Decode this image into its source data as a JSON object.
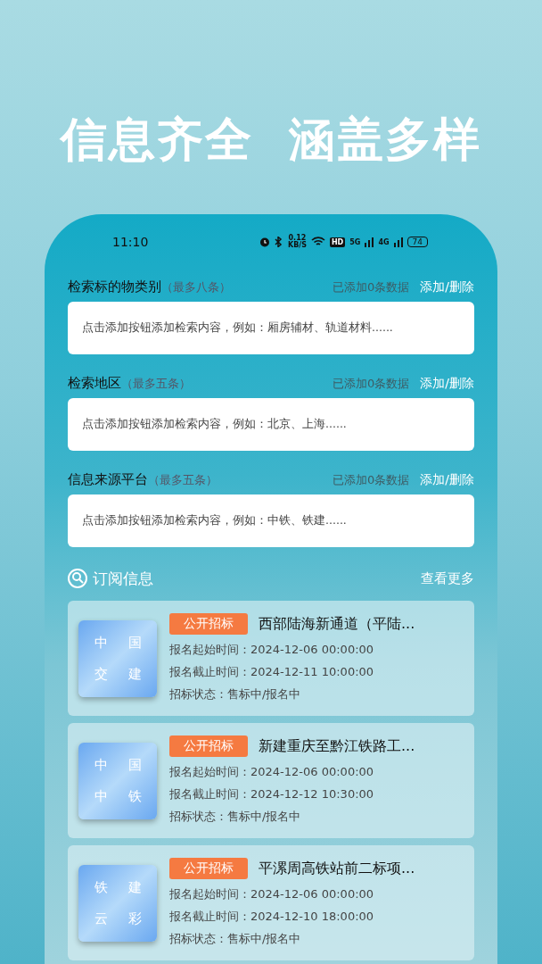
{
  "headline": [
    "信息齐全",
    "涵盖多样"
  ],
  "status_bar": {
    "time": "11:10",
    "speed": "0.12",
    "speed_unit": "KB/S",
    "hd": "HD",
    "net_1": "5G",
    "net_2": "4G",
    "battery": "74"
  },
  "filters": [
    {
      "title": "检索标的物类别",
      "limit": "（最多八条）",
      "count": "已添加0条数据",
      "action": "添加/删除",
      "placeholder": "点击添加按钮添加检索内容，例如：厢房辅材、轨道材料......"
    },
    {
      "title": "检索地区",
      "limit": "（最多五条）",
      "count": "已添加0条数据",
      "action": "添加/删除",
      "placeholder": "点击添加按钮添加检索内容，例如：北京、上海......"
    },
    {
      "title": "信息来源平台",
      "limit": "（最多五条）",
      "count": "已添加0条数据",
      "action": "添加/删除",
      "placeholder": "点击添加按钮添加检索内容，例如：中铁、铁建......"
    }
  ],
  "subscribe": {
    "title": "订阅信息",
    "more": "查看更多",
    "items": [
      {
        "logo": [
          "中",
          "国",
          "交",
          "建"
        ],
        "badge": "公开招标",
        "title": "西部陆海新通道（平陆...",
        "lines": [
          {
            "label": "报名起始时间：",
            "value": "2024-12-06 00:00:00"
          },
          {
            "label": "报名截止时间：",
            "value": "2024-12-11 10:00:00"
          },
          {
            "label": "招标状态：",
            "value": "售标中/报名中"
          }
        ]
      },
      {
        "logo": [
          "中",
          "国",
          "中",
          "铁"
        ],
        "badge": "公开招标",
        "title": "新建重庆至黔江铁路工...",
        "lines": [
          {
            "label": "报名起始时间：",
            "value": "2024-12-06 00:00:00"
          },
          {
            "label": "报名截止时间：",
            "value": "2024-12-12 10:30:00"
          },
          {
            "label": "招标状态：",
            "value": "售标中/报名中"
          }
        ]
      },
      {
        "logo": [
          "铁",
          "建",
          "云",
          "彩"
        ],
        "badge": "公开招标",
        "title": "平漯周高铁站前二标项...",
        "lines": [
          {
            "label": "报名起始时间：",
            "value": "2024-12-06 00:00:00"
          },
          {
            "label": "报名截止时间：",
            "value": "2024-12-10 18:00:00"
          },
          {
            "label": "招标状态：",
            "value": "售标中/报名中"
          }
        ]
      }
    ]
  }
}
